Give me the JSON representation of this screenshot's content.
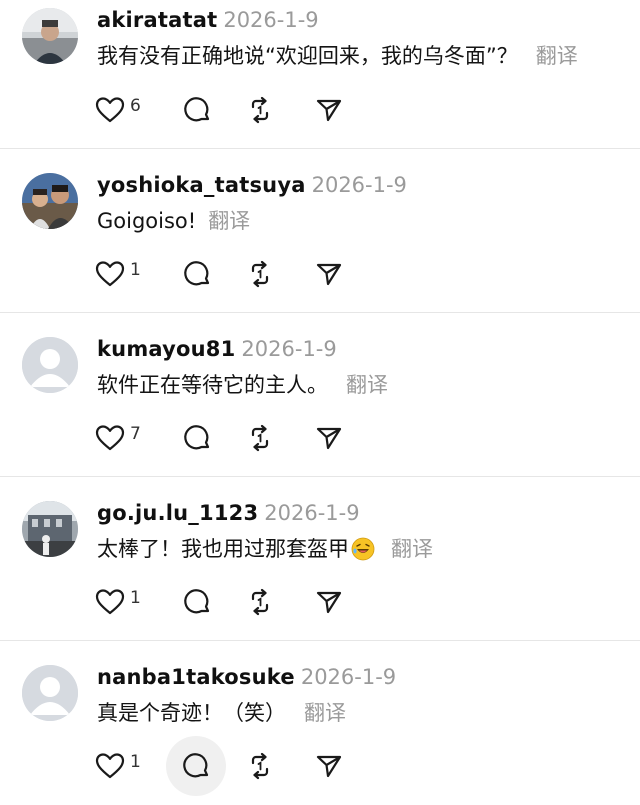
{
  "comments": [
    {
      "username": "akiratatat",
      "date": "2026-1-9",
      "text": "我有没有正确地说“欢迎回来，我的乌冬面”？",
      "translate": "翻译",
      "likes": "6",
      "avatar": "photo-person"
    },
    {
      "username": "yoshioka_tatsuya",
      "date": "2026-1-9",
      "text": "Goigoiso!",
      "translate": "翻译",
      "likes": "1",
      "avatar": "photo-two-people"
    },
    {
      "username": "kumayou81",
      "date": "2026-1-9",
      "text": "软件正在等待它的主人。",
      "translate": "翻译",
      "likes": "7",
      "avatar": "default-user-icon"
    },
    {
      "username": "go.ju.lu_1123",
      "date": "2026-1-9",
      "text": "太棒了！我也用过那套盔甲",
      "translate": "翻译",
      "likes": "1",
      "avatar": "photo-building"
    },
    {
      "username": "nanba1takosuke",
      "date": "2026-1-9",
      "text": "真是个奇迹！（笑）",
      "translate": "翻译",
      "likes": "1",
      "avatar": "default-user-icon"
    }
  ],
  "icons": {
    "like": "heart-icon",
    "reply": "speech-bubble-icon",
    "repost": "repost-icon",
    "share": "paper-plane-icon",
    "emoji": "rolling-laughing-emoji-icon"
  },
  "colors": {
    "text": "#141414",
    "muted": "#9a9a9a",
    "divider": "#e6e6e6",
    "icon": "#1a1a1a"
  }
}
